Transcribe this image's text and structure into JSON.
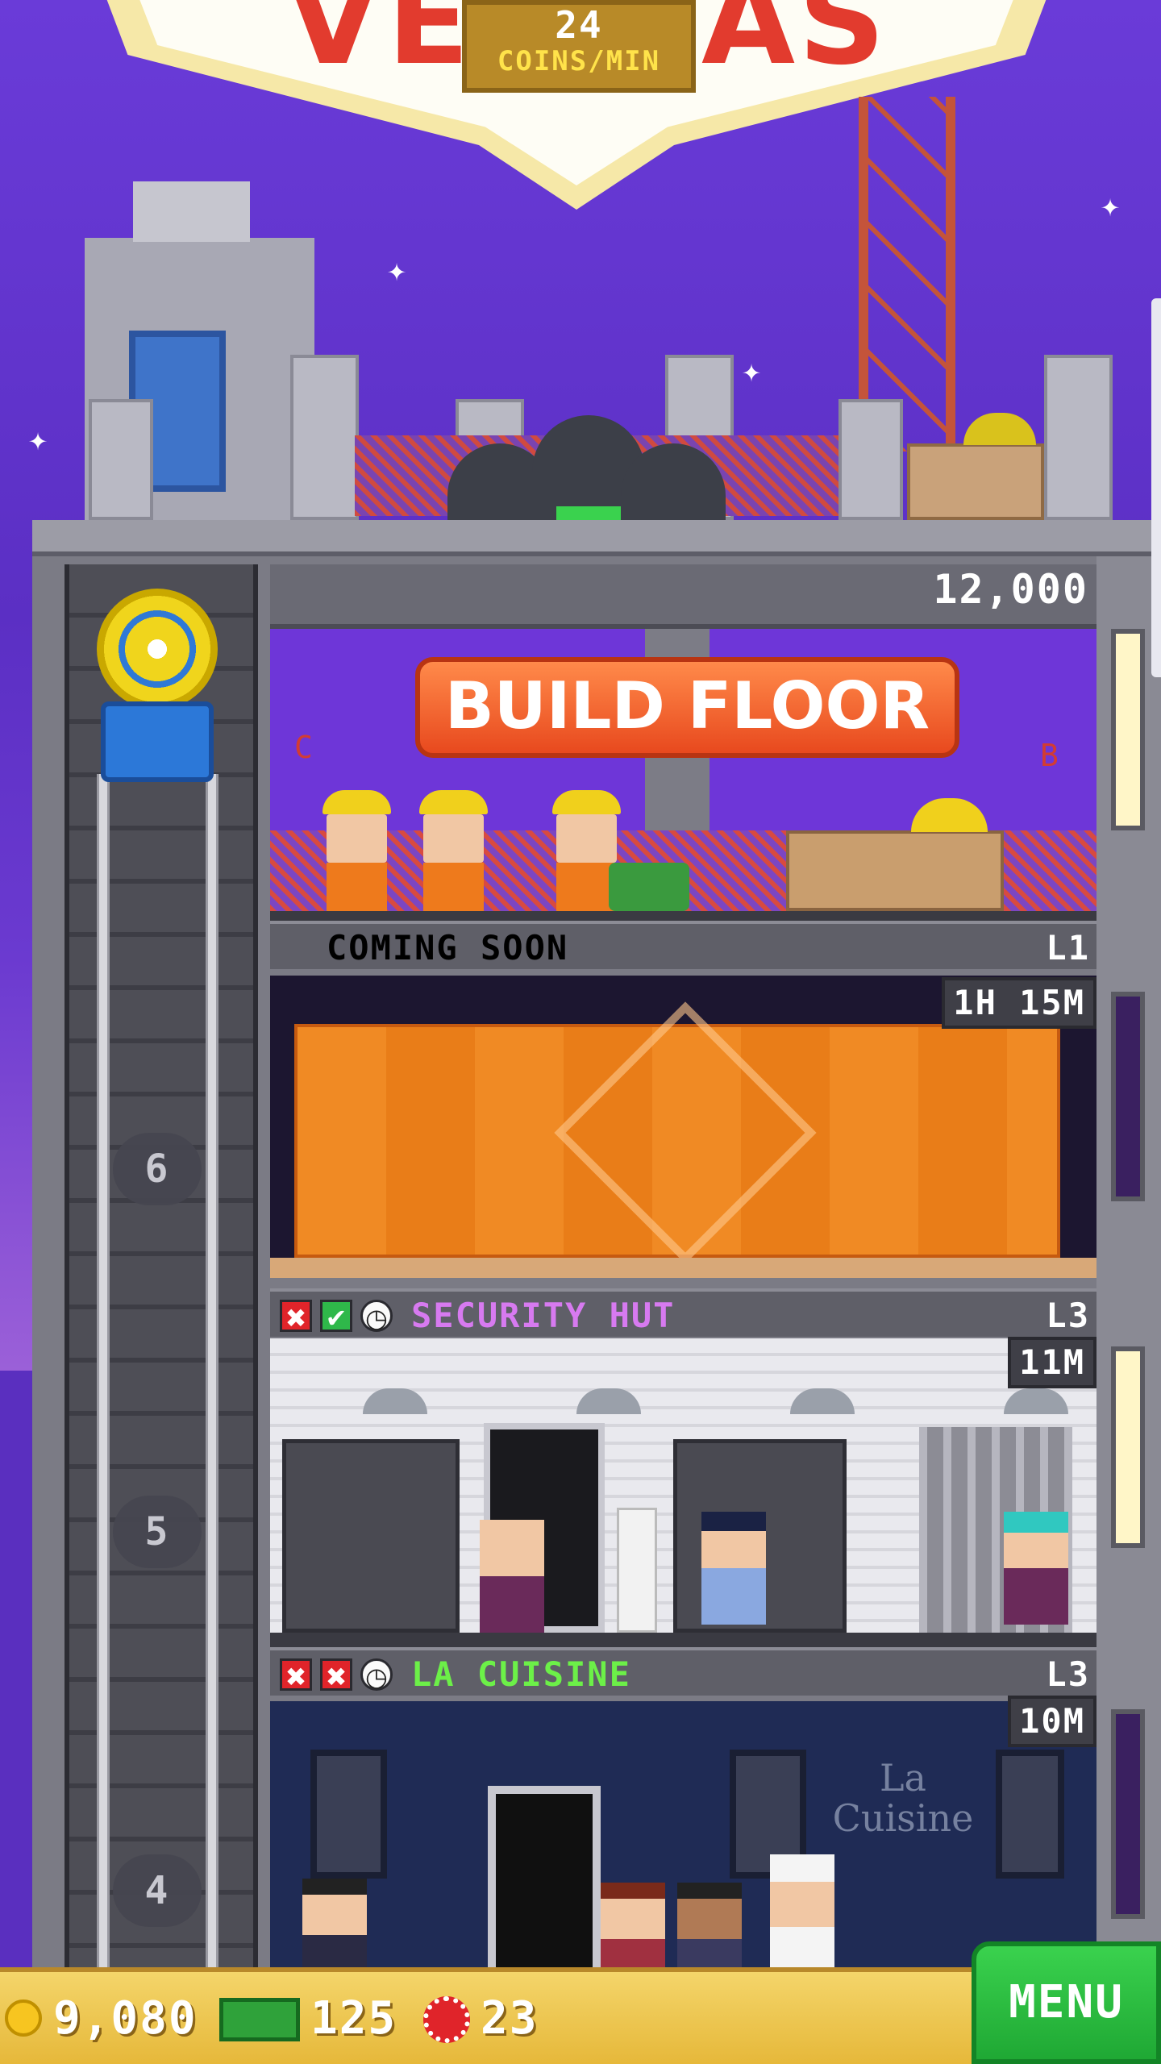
{
  "hud": {
    "rate_value": "24",
    "rate_unit": "COINS/MIN",
    "sign_letters": [
      "V",
      "E",
      "A",
      "S"
    ]
  },
  "build_floor": {
    "cost": "12,000",
    "button_label": "BUILD FLOOR",
    "left_mark": "C",
    "right_mark": "B"
  },
  "floors": [
    {
      "title": "COMING SOON",
      "level": "L1",
      "timer": "1H 15M",
      "title_color": "#ffffff"
    },
    {
      "title": "SECURITY HUT",
      "level": "L3",
      "timer": "11M",
      "title_color": "#d77af0",
      "status_icons": [
        "x-icon",
        "check-icon",
        "clock-icon"
      ],
      "status_glyphs": [
        "✖",
        "✔",
        "◷"
      ]
    },
    {
      "title": "LA CUISINE",
      "level": "L3",
      "timer": "10M",
      "title_color": "#6cf048",
      "status_icons": [
        "x-icon",
        "x-icon",
        "clock-icon"
      ],
      "status_glyphs": [
        "✖",
        "✖",
        "◷"
      ],
      "wall_sign": "La Cuisine"
    }
  ],
  "elevator": {
    "floor_numbers": [
      "6",
      "5",
      "4"
    ]
  },
  "bottom_bar": {
    "coins": "9,080",
    "bux": "125",
    "chips": "23",
    "menu_label": "MENU"
  },
  "colors": {
    "sky": "#5b2fc4",
    "build_button": "#e8491e",
    "menu_button": "#1fa834",
    "bottom_bar": "#e6b83a"
  }
}
